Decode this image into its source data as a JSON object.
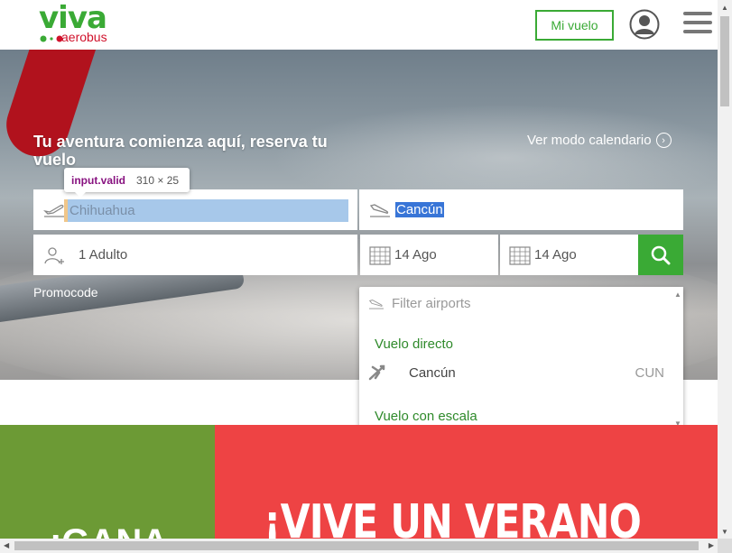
{
  "header": {
    "logo_main": "viva",
    "logo_sub": "aerobus",
    "mi_vuelo_label": "Mi vuelo",
    "account_icon": "user-icon",
    "menu_icon": "hamburger-menu-icon"
  },
  "hero": {
    "title": "Tu aventura comienza aquí, reserva tu vuelo",
    "calendar_link": "Ver modo calendario",
    "origin_value": "Chihuahua",
    "destination_value": "Cancún",
    "passengers_value": "1 Adulto",
    "departure_date": "14 Ago",
    "return_date": "14 Ago",
    "promocode_label": "Promocode"
  },
  "devtools_tooltip": {
    "selector": "input.valid",
    "dimensions": "310 × 25"
  },
  "dropdown": {
    "filter_placeholder": "Filter airports",
    "group_direct": "Vuelo directo",
    "items": [
      {
        "name": "Cancún",
        "code": "CUN"
      }
    ],
    "group_connecting": "Vuelo con escala"
  },
  "banners": {
    "left_text": "¡GANA",
    "right_text": "¡VIVE UN VERANO"
  },
  "colors": {
    "brand_green": "#3aaa35",
    "brand_red": "#d0112b",
    "banner_green": "#6c9a35",
    "banner_red": "#ee4344",
    "selection_blue": "#a7c8ea"
  }
}
